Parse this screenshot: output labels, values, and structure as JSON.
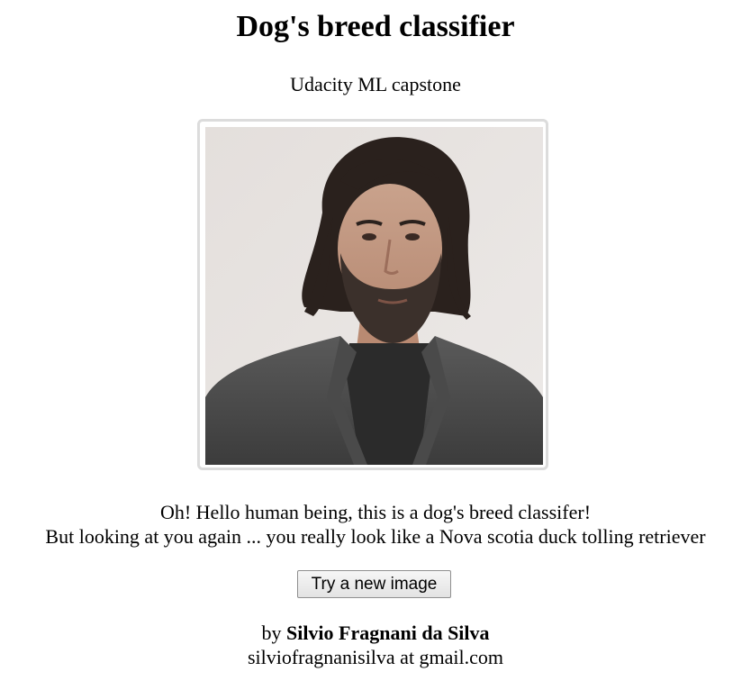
{
  "header": {
    "title": "Dog's breed classifier",
    "subtitle": "Udacity ML capstone"
  },
  "image": {
    "subject": "photo of a man with long dark hair and beard wearing a grey blazer"
  },
  "result": {
    "line1": "Oh! Hello human being, this is a dog's breed classifer!",
    "line2": "But looking at you again ... you really look like a Nova scotia duck tolling retriever"
  },
  "actions": {
    "new_image_label": "Try a new image"
  },
  "footer": {
    "by_prefix": "by",
    "author": "Silvio Fragnani da Silva",
    "email": "silviofragnanisilva at gmail.com"
  },
  "colors": {
    "frame_border": "#dcdcdc",
    "photo_background": "#e9e5e3",
    "button_border": "#8f8f8f"
  }
}
